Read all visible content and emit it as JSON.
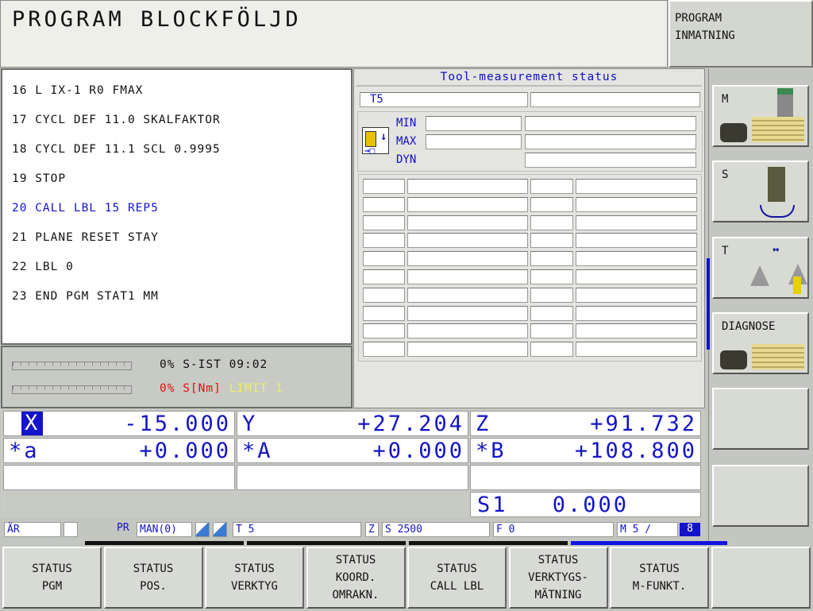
{
  "header": {
    "title": "PROGRAM BLOCKFÖLJD",
    "mode_line1": "PROGRAM",
    "mode_line2": "INMATNING"
  },
  "program": {
    "lines": [
      {
        "text": "16 L IX-1 R0 FMAX",
        "active": false
      },
      {
        "text": "17 CYCL DEF 11.0 SKALFAKTOR",
        "active": false
      },
      {
        "text": "18 CYCL DEF 11.1 SCL 0.9995",
        "active": false
      },
      {
        "text": "19 STOP",
        "active": false
      },
      {
        "text": "20 CALL LBL 15 REP5",
        "active": true
      },
      {
        "text": "21 PLANE RESET STAY",
        "active": false
      },
      {
        "text": "22 LBL 0",
        "active": false
      },
      {
        "text": "23 END PGM STAT1 MM",
        "active": false
      }
    ]
  },
  "load": {
    "line1": "0% S-IST 09:02",
    "line2_red": "0% S[Nm]",
    "line2_yellow": "LIMIT 1",
    "load1_percent": 0,
    "load2_percent": 0
  },
  "tool_status": {
    "title": "Tool-measurement status",
    "tool": "T5",
    "min_label": "MIN",
    "max_label": "MAX",
    "dyn_label": "DYN",
    "table_rows": 10,
    "icon": "tool-measure-icon"
  },
  "positions": [
    {
      "axis": "X",
      "value": "-15.000",
      "highlight": true
    },
    {
      "axis": "Y",
      "value": "+27.204"
    },
    {
      "axis": "Z",
      "value": "+91.732"
    },
    {
      "axis": "*a",
      "value": "+0.000"
    },
    {
      "axis": "*A",
      "value": "+0.000"
    },
    {
      "axis": "*B",
      "value": "+108.800"
    }
  ],
  "spindle": {
    "label": "S1",
    "value": "0.000"
  },
  "status_bar": {
    "mode": "ÄR",
    "pr": "PR",
    "pr_value": "MAN(0)",
    "tool": "T 5",
    "axis": "Z",
    "speed": "S 2500",
    "feed": "F 0",
    "m_func": "M 5 /",
    "m_extra": "8"
  },
  "right_softkeys": [
    {
      "label": "M",
      "icon": "machine-icon"
    },
    {
      "label": "S",
      "icon": "spindle-icon"
    },
    {
      "label": "T",
      "icon": "tool-icon"
    },
    {
      "label": "DIAGNOSE",
      "icon": "machine-table-icon"
    },
    {
      "label": ""
    },
    {
      "label": ""
    }
  ],
  "bottom_softkeys": [
    {
      "lines": [
        "STATUS",
        "PGM"
      ]
    },
    {
      "lines": [
        "STATUS",
        "POS."
      ]
    },
    {
      "lines": [
        "STATUS",
        "VERKTYG"
      ]
    },
    {
      "lines": [
        "STATUS",
        "KOORD.",
        "OMRAKN."
      ]
    },
    {
      "lines": [
        "STATUS",
        "CALL LBL"
      ]
    },
    {
      "lines": [
        "STATUS",
        "VERKTYGS-",
        "MÄTNING"
      ]
    },
    {
      "lines": [
        "STATUS",
        "M-FUNKT."
      ]
    },
    {
      "lines": []
    }
  ],
  "colors": {
    "accent_blue": "#1414c8",
    "alarm_red": "#e01010",
    "limit_yellow": "#f0f060"
  }
}
